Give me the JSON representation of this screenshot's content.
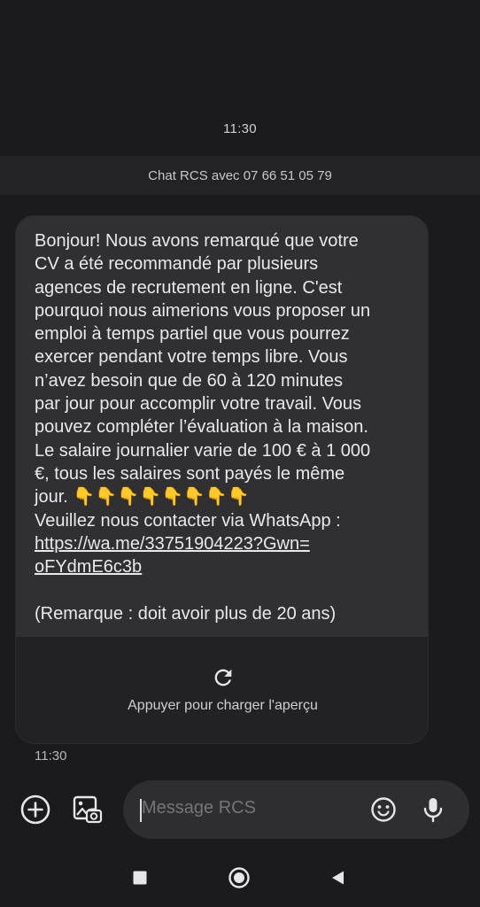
{
  "status_time": "11:30",
  "chat_banner": "Chat RCS avec 07 66 51 05 79",
  "message": {
    "text": "Bonjour! Nous avons remarqué que votre\nCV a été recommandé par plusieurs\nagences de recrutement en ligne. C'est\npourquoi nous aimerions vous proposer un\nemploi à temps partiel que vous pourrez\nexercer pendant votre temps libre. Vous\nn’avez besoin que de 60 à 120 minutes\npar jour pour accomplir votre travail. Vous\npouvez compléter l’évaluation à la maison.\nLe salaire journalier varie de 100 € à 1 000\n€, tous les salaires sont payés le même\njour. 👇👇👇👇👇👇👇👇\nVeuillez nous contacter via WhatsApp :\n",
    "link": "https://wa.me/33751904223?Gwn=\noFYdmE6c3b",
    "note": "\n\n(Remarque : doit avoir plus de 20 ans)",
    "preview_label": "Appuyer pour charger l'aperçu",
    "time": "11:30"
  },
  "compose": {
    "placeholder": "Message RCS"
  },
  "icons": {
    "add": "add-circle-icon",
    "gallery": "gallery-icon",
    "emoji": "emoji-icon",
    "mic": "microphone-icon",
    "refresh": "refresh-icon",
    "nav_recents": "square-icon",
    "nav_home": "circle-icon",
    "nav_back": "triangle-back-icon"
  },
  "colors": {
    "background": "#1b1b1d",
    "bubble": "#303033",
    "preview": "#222224",
    "compose_field": "#2e2e31"
  }
}
